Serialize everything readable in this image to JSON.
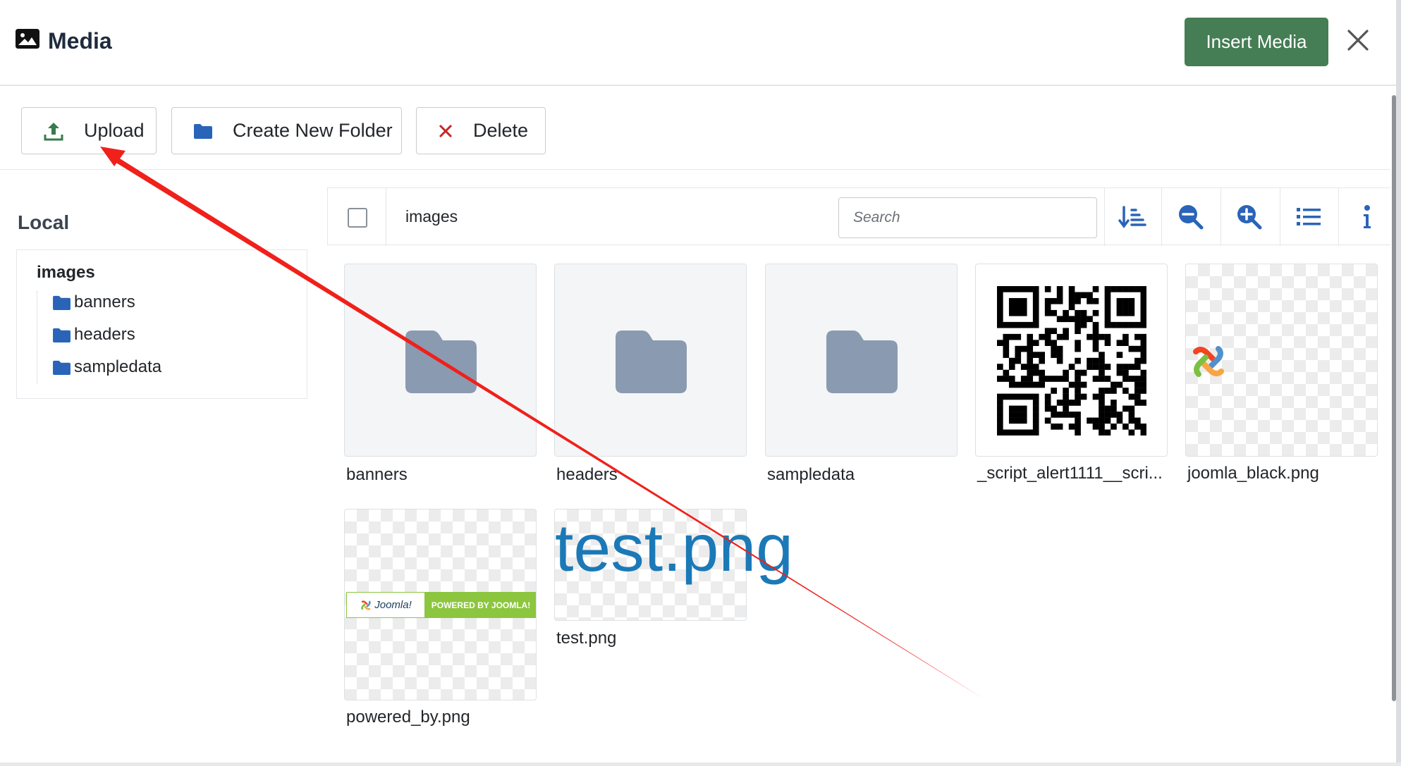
{
  "header": {
    "title": "Media",
    "title_icon": "image-icon",
    "insert_label": "Insert Media",
    "close_icon": "close-icon"
  },
  "toolbar": {
    "upload_label": "Upload",
    "create_folder_label": "Create New Folder",
    "delete_label": "Delete"
  },
  "sidebar": {
    "heading": "Local",
    "root": "images",
    "items": [
      {
        "label": "banners"
      },
      {
        "label": "headers"
      },
      {
        "label": "sampledata"
      }
    ]
  },
  "browser": {
    "breadcrumb": "images",
    "search_placeholder": "Search",
    "header_icons": [
      "sort-icon",
      "zoom-out-icon",
      "zoom-in-icon",
      "list-view-icon",
      "info-icon"
    ]
  },
  "items": [
    {
      "name": "banners",
      "type": "folder"
    },
    {
      "name": "headers",
      "type": "folder"
    },
    {
      "name": "sampledata",
      "type": "folder"
    },
    {
      "name": "_script_alert1111__scri...",
      "type": "image",
      "preview": "qr-code"
    },
    {
      "name": "joomla_black.png",
      "type": "image",
      "preview": "joomla-logo"
    },
    {
      "name": "powered_by.png",
      "type": "image",
      "preview": "powered-by-banner",
      "preview_text": [
        "Joomla!",
        "POWERED BY JOOMLA!"
      ]
    },
    {
      "name": "test.png",
      "type": "image",
      "preview": "text-image",
      "preview_text": "test.png"
    }
  ],
  "colors": {
    "primary_button": "#457d54",
    "icon_blue": "#2a64b8",
    "folder_gray": "#8a9ab0",
    "delete_red": "#c52827",
    "annotation_arrow": "#f0201a"
  }
}
